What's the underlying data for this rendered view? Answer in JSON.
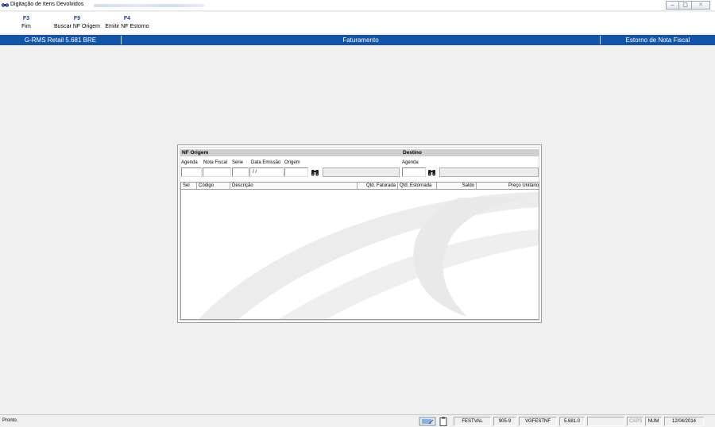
{
  "window": {
    "title": "Digitação de Itens Devolvidos",
    "controls": {
      "minimize": "‒",
      "maximize": "▢",
      "close": "✕"
    }
  },
  "toolbar": {
    "keys": [
      {
        "key": "F3",
        "label": "Fim"
      },
      {
        "key": "F9",
        "label": "Buscar NF Origem"
      },
      {
        "key": "F4",
        "label": "Emitir NF Estorno"
      }
    ]
  },
  "header": {
    "left": "G-RMS Retail 5.681 BRE",
    "center": "Faturamento",
    "right": "Estorno de Nota Fiscal",
    "color": "#1453a6"
  },
  "form": {
    "nf_origem": {
      "title": "NF Origem",
      "labels": {
        "agenda": "Agenda",
        "nota_fiscal": "Nota Fiscal",
        "serie": "Série",
        "data_emissao": "Data Emissão",
        "origem": "Origem"
      },
      "values": {
        "agenda": "",
        "nota_fiscal": "",
        "serie": "",
        "data_emissao": " / /",
        "origem": "",
        "description": ""
      },
      "search_icon": "binoculars-icon"
    },
    "destino": {
      "title": "Destino",
      "labels": {
        "agenda": "Agenda"
      },
      "values": {
        "agenda": "",
        "description": ""
      },
      "search_icon": "binoculars-icon"
    }
  },
  "grid": {
    "columns": [
      "Sel",
      "Código",
      "Descrição",
      "Qtd. Faturada",
      "Qtd. Estornada",
      "Saldo",
      "Preço Unitário"
    ],
    "rows": []
  },
  "statusbar": {
    "status": "Pronto.",
    "cells": [
      "FESTVAL",
      "905-9",
      "VGFESTNF",
      "5.681.0",
      "",
      "CAPS",
      "NUM",
      "12/04/2014"
    ]
  }
}
